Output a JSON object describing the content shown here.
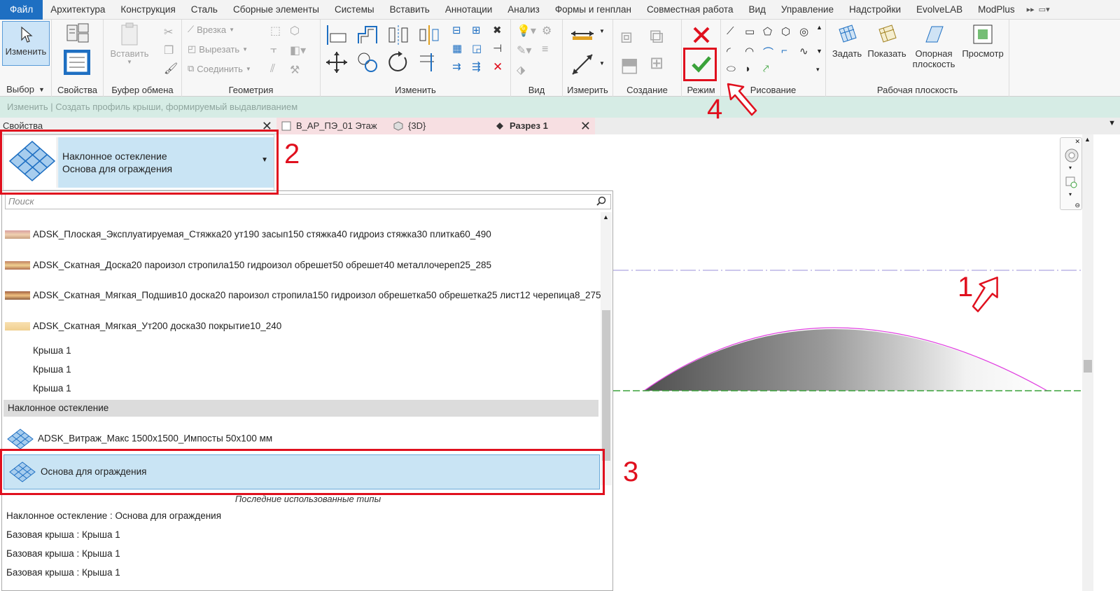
{
  "menu": {
    "file": "Файл",
    "tabs": [
      "Архитектура",
      "Конструкция",
      "Сталь",
      "Сборные элементы",
      "Системы",
      "Вставить",
      "Аннотации",
      "Анализ",
      "Формы и генплан",
      "Совместная работа",
      "Вид",
      "Управление",
      "Надстройки",
      "EvolveLAB",
      "ModPlus"
    ]
  },
  "ribbon": {
    "modify_label": "Изменить",
    "select_label": "Выбор",
    "properties_label": "Свойства",
    "paste_label": "Вставить",
    "clipboard_label": "Буфер обмена",
    "cut_label": "Врезка",
    "cut_out_label": "Вырезать",
    "join_label": "Соединить",
    "geometry_label": "Геометрия",
    "modify_panel_label": "Изменить",
    "view_label": "Вид",
    "measure_label": "Измерить",
    "create_label": "Создание",
    "mode_label": "Режим",
    "draw_label": "Рисование",
    "set_label": "Задать",
    "show_label": "Показать",
    "ref_plane_label_1": "Опорная",
    "ref_plane_label_2": "плоскость",
    "viewer_label": "Просмотр",
    "workplane_label": "Рабочая плоскость"
  },
  "context_bar": "Изменить | Создать профиль крыши, формируемый выдавливанием",
  "properties": {
    "title": "Свойства",
    "type_family": "Наклонное остекление",
    "type_name": "Основа для ограждения"
  },
  "view_tabs": [
    {
      "label": "В_АР_ПЭ_01 Этаж"
    },
    {
      "label": "{3D}"
    },
    {
      "label": "Разрез 1"
    }
  ],
  "dropdown": {
    "search_placeholder": "Поиск",
    "items": [
      "ADSK_Плоская_Эксплуатируемая_Стяжка20 ут190 засып150 стяжка40 гидроиз стяжка30 плитка60_490",
      "ADSK_Скатная_Доска20 пароизол стропила150 гидроизол обрешет50 обрешет40 металлочереп25_285",
      "ADSK_Скатная_Мягкая_Подшив10 доска20 пароизол стропила150 гидроизол обрешетка50 обрешетка25 лист12 черепица8_275",
      "ADSK_Скатная_Мягкая_Ут200 доска30 покрытие10_240",
      "Крыша 1",
      "Крыша 1",
      "Крыша 1"
    ],
    "group_label": "Наклонное остекление",
    "glazing_items": [
      "ADSK_Витраж_Макс 1500x1500_Импосты 50x100 мм",
      "Основа для ограждения"
    ],
    "recent_title": "Последние использованные типы",
    "recent": [
      "Наклонное остекление : Основа для ограждения",
      "Базовая крыша : Крыша 1",
      "Базовая крыша : Крыша 1",
      "Базовая крыша : Крыша 1"
    ]
  },
  "annotations": {
    "n1": "1",
    "n2": "2",
    "n3": "3",
    "n4": "4"
  },
  "colors": {
    "accent": "#1e6fc2",
    "annotation": "#e0101e",
    "selection": "#c9e4f4",
    "context_bar": "#d6ece5"
  }
}
